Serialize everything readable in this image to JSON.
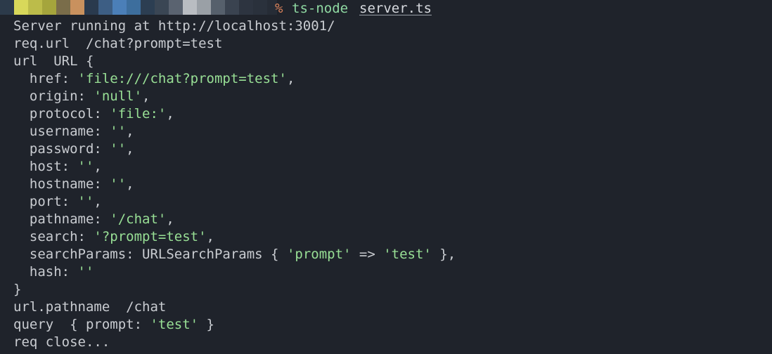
{
  "prompt": {
    "symbol": "%",
    "command": "ts-node",
    "argument": "server.ts",
    "redacted_colors": [
      "#2c3a4a",
      "#d8d85a",
      "#bcbc4a",
      "#a5a53c",
      "#7a6d4a",
      "#c9915e",
      "#2a3a4e",
      "#3d5e84",
      "#4b7fb8",
      "#3d6e9d",
      "#2c3e52",
      "#3a4654",
      "#5a6370",
      "#b9bdc2",
      "#9aa0a6",
      "#56606c",
      "#3a4350",
      "#2d3440",
      "#2a313c",
      "#262c36"
    ]
  },
  "lines": [
    {
      "name": "server-running-line",
      "segments": [
        {
          "t": "Server running at http://localhost:3001/",
          "c": "k"
        }
      ]
    },
    {
      "name": "req-url-line",
      "segments": [
        {
          "t": "req.url  /chat?prompt=test",
          "c": "k"
        }
      ]
    },
    {
      "name": "url-open-line",
      "segments": [
        {
          "t": "url  URL {",
          "c": "k"
        }
      ]
    },
    {
      "name": "href-line",
      "segments": [
        {
          "t": "  href: ",
          "c": "k"
        },
        {
          "t": "'file:///chat?prompt=test'",
          "c": "s"
        },
        {
          "t": ",",
          "c": "k"
        }
      ]
    },
    {
      "name": "origin-line",
      "segments": [
        {
          "t": "  origin: ",
          "c": "k"
        },
        {
          "t": "'null'",
          "c": "s"
        },
        {
          "t": ",",
          "c": "k"
        }
      ]
    },
    {
      "name": "protocol-line",
      "segments": [
        {
          "t": "  protocol: ",
          "c": "k"
        },
        {
          "t": "'file:'",
          "c": "s"
        },
        {
          "t": ",",
          "c": "k"
        }
      ]
    },
    {
      "name": "username-line",
      "segments": [
        {
          "t": "  username: ",
          "c": "k"
        },
        {
          "t": "''",
          "c": "s"
        },
        {
          "t": ",",
          "c": "k"
        }
      ]
    },
    {
      "name": "password-line",
      "segments": [
        {
          "t": "  password: ",
          "c": "k"
        },
        {
          "t": "''",
          "c": "s"
        },
        {
          "t": ",",
          "c": "k"
        }
      ]
    },
    {
      "name": "host-line",
      "segments": [
        {
          "t": "  host: ",
          "c": "k"
        },
        {
          "t": "''",
          "c": "s"
        },
        {
          "t": ",",
          "c": "k"
        }
      ]
    },
    {
      "name": "hostname-line",
      "segments": [
        {
          "t": "  hostname: ",
          "c": "k"
        },
        {
          "t": "''",
          "c": "s"
        },
        {
          "t": ",",
          "c": "k"
        }
      ]
    },
    {
      "name": "port-line",
      "segments": [
        {
          "t": "  port: ",
          "c": "k"
        },
        {
          "t": "''",
          "c": "s"
        },
        {
          "t": ",",
          "c": "k"
        }
      ]
    },
    {
      "name": "pathname-line",
      "segments": [
        {
          "t": "  pathname: ",
          "c": "k"
        },
        {
          "t": "'/chat'",
          "c": "s"
        },
        {
          "t": ",",
          "c": "k"
        }
      ]
    },
    {
      "name": "search-line",
      "segments": [
        {
          "t": "  search: ",
          "c": "k"
        },
        {
          "t": "'?prompt=test'",
          "c": "s"
        },
        {
          "t": ",",
          "c": "k"
        }
      ]
    },
    {
      "name": "searchparams-line",
      "segments": [
        {
          "t": "  searchParams: URLSearchParams { ",
          "c": "k"
        },
        {
          "t": "'prompt'",
          "c": "s"
        },
        {
          "t": " => ",
          "c": "k"
        },
        {
          "t": "'test'",
          "c": "s"
        },
        {
          "t": " },",
          "c": "k"
        }
      ]
    },
    {
      "name": "hash-line",
      "segments": [
        {
          "t": "  hash: ",
          "c": "k"
        },
        {
          "t": "''",
          "c": "s"
        }
      ]
    },
    {
      "name": "url-close-line",
      "segments": [
        {
          "t": "}",
          "c": "k"
        }
      ]
    },
    {
      "name": "url-pathname-line",
      "segments": [
        {
          "t": "url.pathname  /chat",
          "c": "k"
        }
      ]
    },
    {
      "name": "query-line",
      "segments": [
        {
          "t": "query  { prompt: ",
          "c": "k"
        },
        {
          "t": "'test'",
          "c": "s"
        },
        {
          "t": " }",
          "c": "k"
        }
      ]
    },
    {
      "name": "req-close-line",
      "segments": [
        {
          "t": "req close...",
          "c": "k"
        }
      ]
    }
  ]
}
